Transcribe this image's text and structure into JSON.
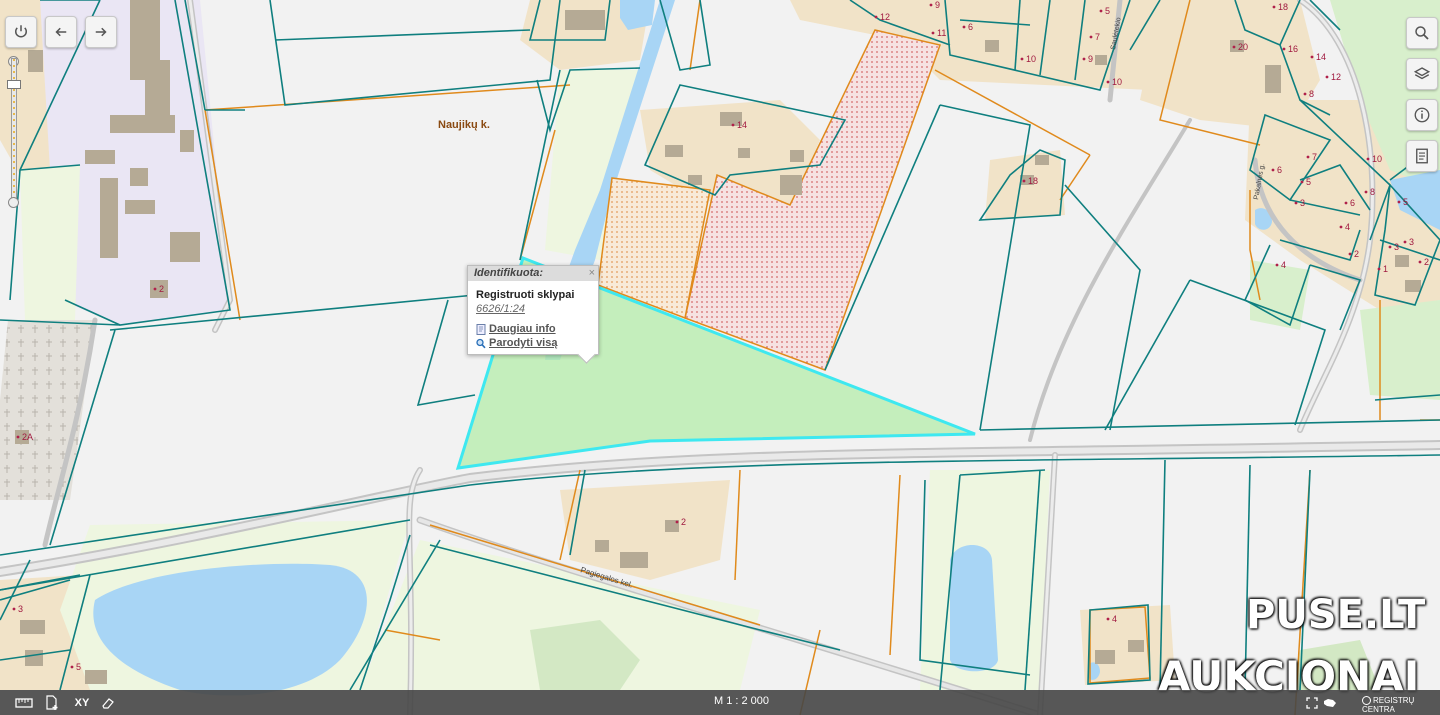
{
  "toolbar": {
    "power_icon": "power-icon",
    "back_icon": "arrow-left-icon",
    "forward_icon": "arrow-right-icon"
  },
  "right_controls": [
    "search-icon",
    "layers-icon",
    "info-icon",
    "document-icon"
  ],
  "map": {
    "village_label": "Naujikų k.",
    "road_label_1": "Pagiegalos kel.",
    "road_label_2": "Saulėtekio",
    "road_label_3": "Pakalnės g.",
    "parcel_numbers": [
      "2",
      "14",
      "18",
      "2",
      "3",
      "5",
      "2A",
      "4",
      "4",
      "6",
      "12",
      "11",
      "9",
      "10",
      "10",
      "5",
      "7",
      "9",
      "18",
      "20",
      "16",
      "14",
      "12",
      "8",
      "6",
      "7",
      "5",
      "3",
      "2",
      "10",
      "8",
      "6",
      "4",
      "3",
      "1",
      "5",
      "3",
      "2"
    ]
  },
  "popup": {
    "title": "Identifikuota:",
    "close": "×",
    "layer": "Registruoti sklypai",
    "id": "6626/1:24",
    "more_info": "Daugiau info",
    "show_all": "Parodyti visą"
  },
  "bottom_bar": {
    "tools": [
      "ruler-icon",
      "add-document-icon",
      "XY",
      "eraser-icon"
    ],
    "xy_label": "XY",
    "scale": "M 1 : 2 000",
    "brand": "REGISTRŲ CENTRA"
  },
  "watermark": {
    "line1": "PUSE.LT",
    "line2": "AUKCIONAI"
  },
  "colors": {
    "parcel_border": "#0f7f7f",
    "selected_parcel": "#3ee8f0",
    "selected_fill": "#b4ecaa",
    "orange_border": "#e08a1c",
    "water": "#a8d5f5",
    "building": "#b5aa95",
    "built_area": "#f1e3c8",
    "road": "#b8b8b8"
  }
}
